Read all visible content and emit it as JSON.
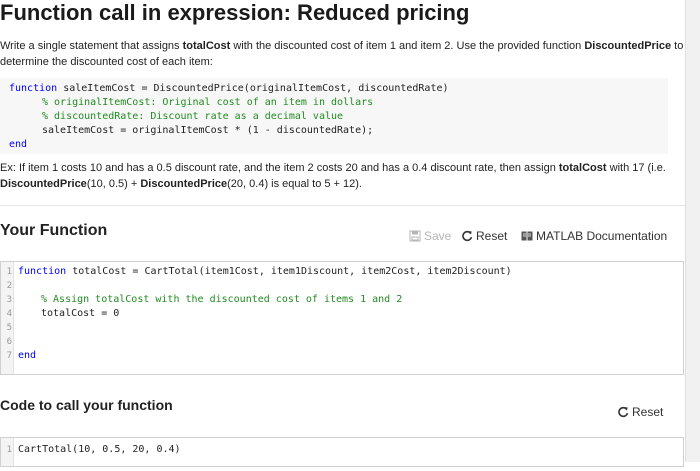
{
  "title": "Function call in expression: Reduced pricing",
  "description": {
    "t1": "Write a single statement that assigns ",
    "b1": "totalCost",
    "t2": " with the discounted cost of item 1 and item 2. Use the provided function ",
    "b2": "DiscountedPrice",
    "t3": " to determine the discounted cost of each item:"
  },
  "provided_code": {
    "line1_kw": "function",
    "line1_rest": " saleItemCost = DiscountedPrice(originalItemCost, discountedRate)",
    "line2": "% originalItemCost: Original cost of an item in dollars",
    "line3": "% discountedRate: Discount rate as a decimal value",
    "line4": "saleItemCost = originalItemCost * (1 - discountedRate);",
    "line5_kw": "end"
  },
  "example": {
    "t1": "Ex: If item 1 costs 10 and has a 0.5 discount rate, and the item 2 costs 20 and has a 0.4 discount rate, then assign ",
    "b1": "totalCost",
    "t2": " with 17 (i.e. ",
    "b2": "DiscountedPrice",
    "t3": "(10, 0.5) + ",
    "b3": "DiscountedPrice",
    "t4": "(20, 0.4) is equal to 5 + 12)."
  },
  "your_function": {
    "heading": "Your Function",
    "save_label": "Save",
    "reset_label": "Reset",
    "docs_label": "MATLAB Documentation",
    "line_numbers": [
      "1",
      "2",
      "3",
      "4",
      "5",
      "6",
      "7"
    ],
    "line1_kw": "function",
    "line1_rest": " totalCost = CartTotal(item1Cost, item1Discount, item2Cost, item2Discount)",
    "line3": "% Assign totalCost with the discounted cost of items 1 and 2",
    "line4": "totalCost = 0",
    "line7_kw": "end"
  },
  "call_section": {
    "heading": "Code to call your function",
    "reset_label": "Reset",
    "line_numbers": [
      "1"
    ],
    "line1": "CartTotal(10, 0.5, 20, 0.4)"
  },
  "colors": {
    "keyword": "#0000ff",
    "comment": "#228b22",
    "disabled": "#b5b5b5"
  },
  "icons": [
    "save-icon",
    "reset-icon",
    "matlab-doc-icon"
  ]
}
